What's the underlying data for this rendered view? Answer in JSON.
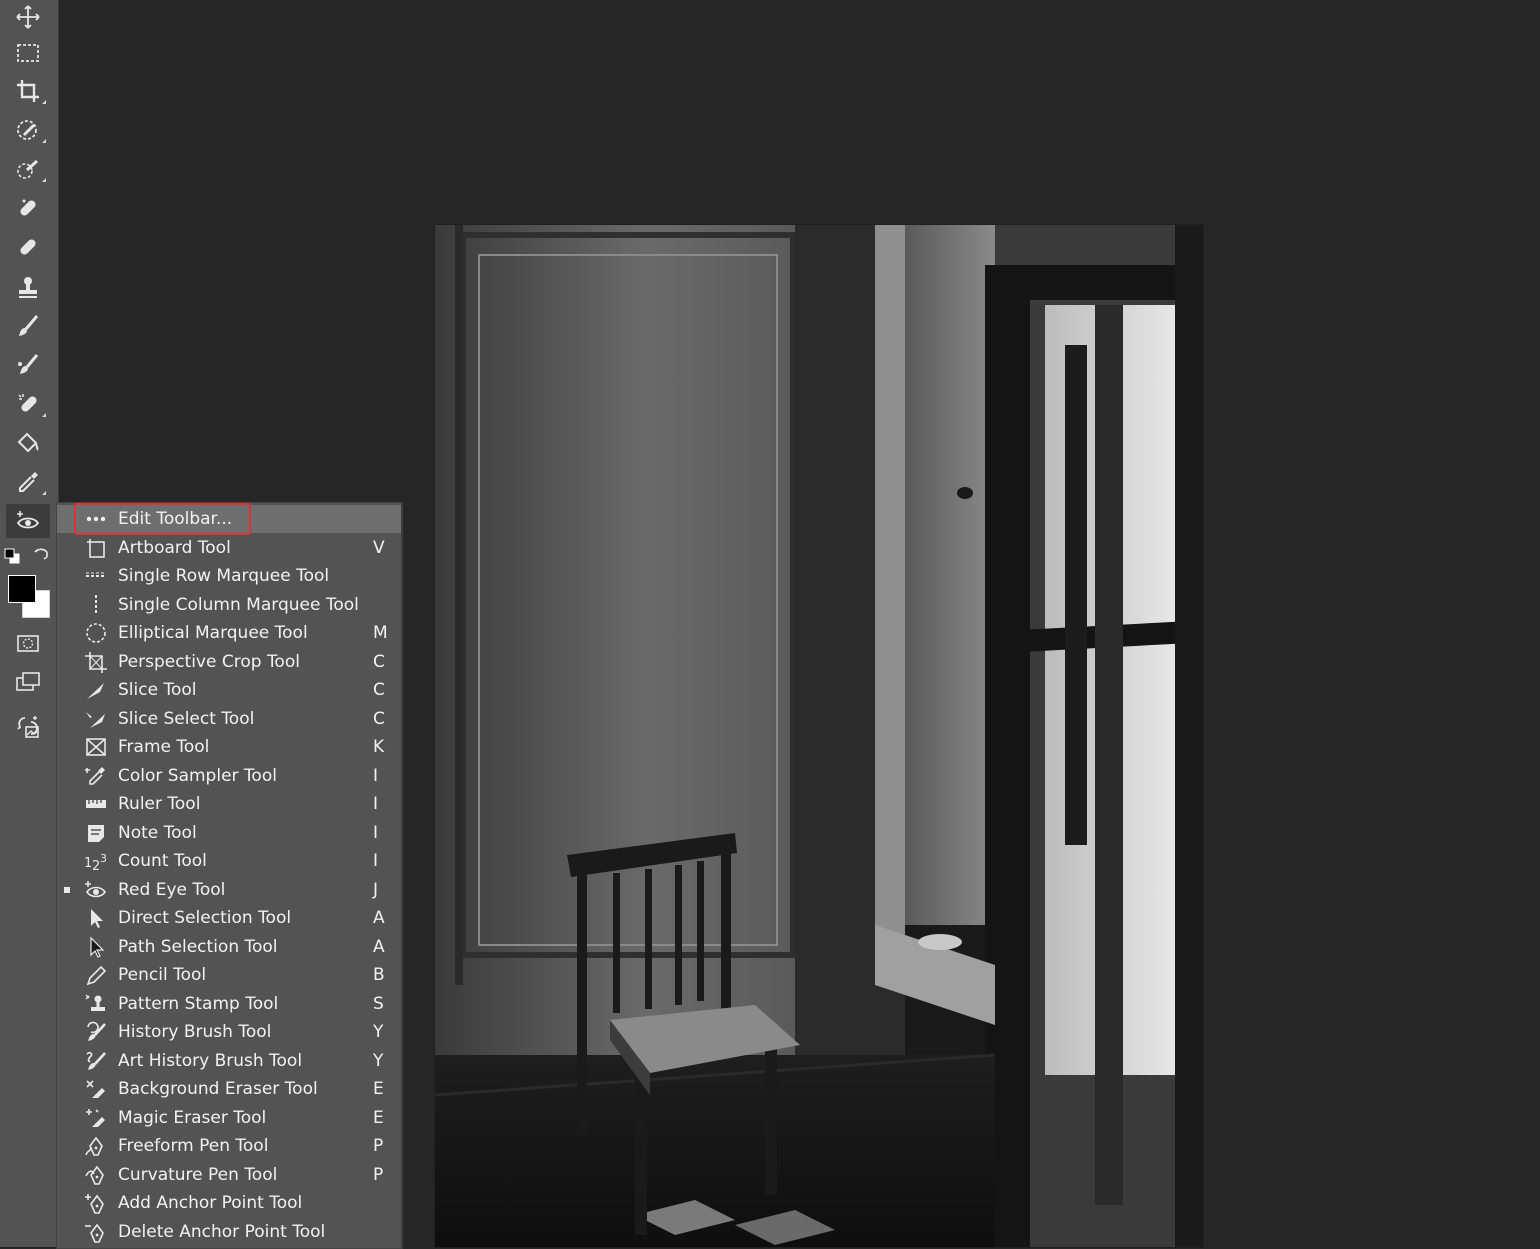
{
  "toolbar": {
    "tools": [
      {
        "icon": "move-icon"
      },
      {
        "icon": "rectangular-marquee-icon"
      },
      {
        "icon": "crop-icon"
      },
      {
        "icon": "object-selection-icon"
      },
      {
        "icon": "quick-selection-icon"
      },
      {
        "icon": "spot-healing-brush-icon"
      },
      {
        "icon": "healing-brush-icon"
      },
      {
        "icon": "clone-stamp-icon"
      },
      {
        "icon": "brush-icon"
      },
      {
        "icon": "mixer-brush-icon"
      },
      {
        "icon": "content-aware-icon"
      },
      {
        "icon": "paint-bucket-icon"
      },
      {
        "icon": "eyedropper-icon"
      },
      {
        "icon": "red-eye-icon",
        "active": true
      }
    ],
    "foreground_color": "#000000",
    "background_color": "#ffffff",
    "bottom_icons": [
      "quick-mask-icon",
      "screen-mode-icon",
      "generative-icon"
    ]
  },
  "flyout": {
    "edit_toolbar": {
      "label": "Edit Toolbar...",
      "icon": "ellipsis-icon"
    },
    "items": [
      {
        "label": "Artboard Tool",
        "key": "V",
        "icon": "artboard-icon"
      },
      {
        "label": "Single Row Marquee Tool",
        "key": "",
        "icon": "single-row-marquee-icon"
      },
      {
        "label": "Single Column Marquee Tool",
        "key": "",
        "icon": "single-column-marquee-icon"
      },
      {
        "label": "Elliptical Marquee Tool",
        "key": "M",
        "icon": "elliptical-marquee-icon"
      },
      {
        "label": "Perspective Crop Tool",
        "key": "C",
        "icon": "perspective-crop-icon"
      },
      {
        "label": "Slice Tool",
        "key": "C",
        "icon": "slice-icon"
      },
      {
        "label": "Slice Select Tool",
        "key": "C",
        "icon": "slice-select-icon"
      },
      {
        "label": "Frame Tool",
        "key": "K",
        "icon": "frame-icon"
      },
      {
        "label": "Color Sampler Tool",
        "key": "I",
        "icon": "color-sampler-icon"
      },
      {
        "label": "Ruler Tool",
        "key": "I",
        "icon": "ruler-icon"
      },
      {
        "label": "Note Tool",
        "key": "I",
        "icon": "note-icon"
      },
      {
        "label": "Count Tool",
        "key": "I",
        "icon": "count-icon"
      },
      {
        "label": "Red Eye Tool",
        "key": "J",
        "icon": "red-eye-icon",
        "selected": true
      },
      {
        "label": "Direct Selection Tool",
        "key": "A",
        "icon": "direct-selection-icon"
      },
      {
        "label": "Path Selection Tool",
        "key": "A",
        "icon": "path-selection-icon"
      },
      {
        "label": "Pencil Tool",
        "key": "B",
        "icon": "pencil-icon"
      },
      {
        "label": "Pattern Stamp Tool",
        "key": "S",
        "icon": "pattern-stamp-icon"
      },
      {
        "label": "History Brush Tool",
        "key": "Y",
        "icon": "history-brush-icon"
      },
      {
        "label": "Art History Brush Tool",
        "key": "Y",
        "icon": "art-history-brush-icon"
      },
      {
        "label": "Background Eraser Tool",
        "key": "E",
        "icon": "background-eraser-icon"
      },
      {
        "label": "Magic Eraser Tool",
        "key": "E",
        "icon": "magic-eraser-icon"
      },
      {
        "label": "Freeform Pen Tool",
        "key": "P",
        "icon": "freeform-pen-icon"
      },
      {
        "label": "Curvature Pen Tool",
        "key": "P",
        "icon": "curvature-pen-icon"
      },
      {
        "label": "Add Anchor Point Tool",
        "key": "",
        "icon": "add-anchor-point-icon"
      },
      {
        "label": "Delete Anchor Point Tool",
        "key": "",
        "icon": "delete-anchor-point-icon"
      }
    ]
  },
  "canvas": {
    "content": "black-and-white-photo",
    "accent_highlight": "#e03232"
  }
}
